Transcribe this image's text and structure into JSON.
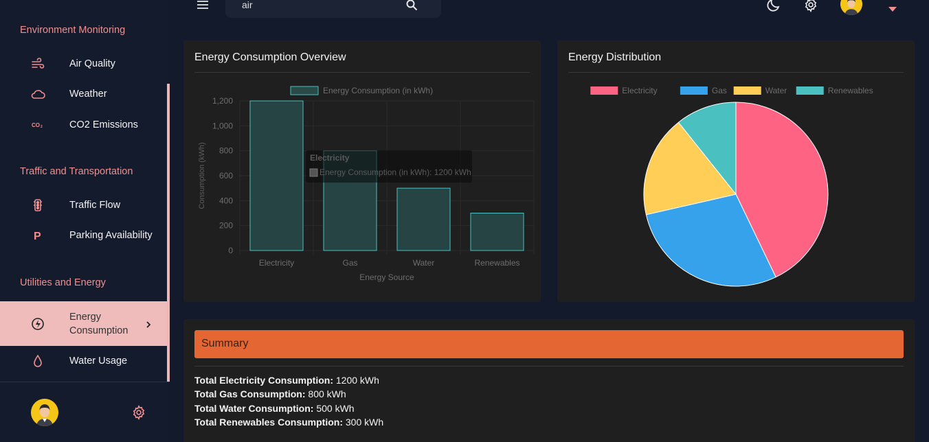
{
  "sidebar": {
    "sections": [
      {
        "title": "Environment Monitoring",
        "items": [
          {
            "label": "Air Quality",
            "icon": "wind-icon"
          },
          {
            "label": "Weather",
            "icon": "cloud-icon"
          },
          {
            "label": "CO2 Emissions",
            "icon": "co2-icon"
          }
        ]
      },
      {
        "title": "Traffic and Transportation",
        "items": [
          {
            "label": "Traffic Flow",
            "icon": "traffic-light-icon"
          },
          {
            "label": "Parking Availability",
            "icon": "parking-icon"
          }
        ]
      },
      {
        "title": "Utilities and Energy",
        "items": [
          {
            "label": "Energy Consumption",
            "icon": "bolt-icon",
            "active": true
          },
          {
            "label": "Water Usage",
            "icon": "water-drop-icon"
          }
        ]
      }
    ]
  },
  "topbar": {
    "search_value": "air"
  },
  "colors": {
    "accent": "#f08f8f",
    "summary": "#e36633",
    "electricity": "#ff6384",
    "gas": "#36a2eb",
    "water": "#ffce56",
    "renewables": "#4bc0c0"
  },
  "bar_card": {
    "title": "Energy Consumption Overview"
  },
  "pie_card": {
    "title": "Energy Distribution"
  },
  "tooltip": {
    "title": "Electricity",
    "body": "Energy Consumption (in kWh): 1200 kWh"
  },
  "chart_data": [
    {
      "type": "bar",
      "categories": [
        "Electricity",
        "Gas",
        "Water",
        "Renewables"
      ],
      "series": [
        {
          "name": "Energy Consumption (in kWh)",
          "values": [
            1200,
            800,
            500,
            300
          ]
        }
      ],
      "xlabel": "Energy Source",
      "ylabel": "Consumption (kWh)",
      "ylim": [
        0,
        1200
      ],
      "yticks": [
        "0",
        "200",
        "400",
        "600",
        "800",
        "1,000",
        "1,200"
      ],
      "legend": "top"
    },
    {
      "type": "pie",
      "categories": [
        "Electricity",
        "Gas",
        "Water",
        "Renewables"
      ],
      "values": [
        1200,
        800,
        500,
        300
      ],
      "legend": "top"
    }
  ],
  "summary": {
    "title": "Summary",
    "lines": [
      {
        "label": "Total Electricity Consumption:",
        "value": "1200 kWh"
      },
      {
        "label": "Total Gas Consumption:",
        "value": "800 kWh"
      },
      {
        "label": "Total Water Consumption:",
        "value": "500 kWh"
      },
      {
        "label": "Total Renewables Consumption:",
        "value": "300 kWh"
      }
    ]
  }
}
